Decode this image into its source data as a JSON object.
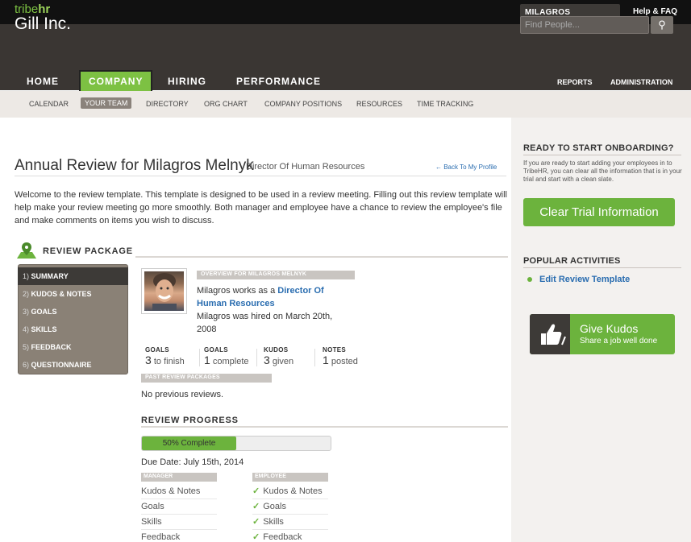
{
  "topbar": {
    "logo_tribe": "tribe",
    "logo_hr": "hr",
    "user_name": "MILAGROS MELNYK",
    "help": "Help & FAQ"
  },
  "header": {
    "company": "Gill Inc.",
    "search_placeholder": "Find People...",
    "nav": [
      "HOME",
      "COMPANY",
      "HIRING",
      "PERFORMANCE"
    ],
    "nav_active": "COMPANY",
    "nav_right": [
      "REPORTS",
      "ADMINISTRATION"
    ]
  },
  "subnav": [
    "CALENDAR",
    "YOUR TEAM",
    "DIRECTORY",
    "ORG CHART",
    "COMPANY POSITIONS",
    "RESOURCES",
    "TIME TRACKING"
  ],
  "subnav_active": "YOUR TEAM",
  "page": {
    "title": "Annual Review for Milagros Melnyk",
    "subtitle": "Director Of Human Resources",
    "back_link": "← Back To My Profile",
    "intro": "Welcome to the review template. This template is designed to be used in a review meeting. Filling out this review template will help make your review meeting go more smoothly. Both manager and employee have a chance to review the employee's file and make comments on items you wish to discuss."
  },
  "review_package": {
    "heading": "REVIEW PACKAGE",
    "menu": [
      {
        "num": "1)",
        "label": "SUMMARY"
      },
      {
        "num": "2)",
        "label": "KUDOS & NOTES"
      },
      {
        "num": "3)",
        "label": "GOALS"
      },
      {
        "num": "4)",
        "label": "SKILLS"
      },
      {
        "num": "5)",
        "label": "FEEDBACK"
      },
      {
        "num": "6)",
        "label": "QUESTIONNAIRE"
      }
    ],
    "overview_label": "OVERVIEW FOR MILAGROS MELNYK",
    "overview_line1": "Milagros works as a ",
    "overview_link": "Director Of Human Resources",
    "overview_line2": "Milagros was hired on March 20th, 2008",
    "stats": [
      {
        "label": "GOALS",
        "value": "3",
        "suffix": "to finish"
      },
      {
        "label": "GOALS",
        "value": "1",
        "suffix": "complete"
      },
      {
        "label": "KUDOS",
        "value": "3",
        "suffix": "given"
      },
      {
        "label": "NOTES",
        "value": "1",
        "suffix": "posted"
      }
    ],
    "past_label": "PAST REVIEW PACKAGES",
    "past_text": "No previous reviews."
  },
  "progress": {
    "heading": "REVIEW PROGRESS",
    "label": "50% Complete",
    "percent": 50,
    "due_date": "Due Date: July 15th, 2014",
    "manager_label": "MANAGER",
    "employee_label": "EMPLOYEE",
    "manager_items": [
      "Kudos & Notes",
      "Goals",
      "Skills",
      "Feedback"
    ],
    "employee_items": [
      "Kudos & Notes",
      "Goals",
      "Skills",
      "Feedback"
    ]
  },
  "sidebar": {
    "onboard_heading": "READY TO START ONBOARDING?",
    "onboard_text": "If you are ready to start adding your employees in to TribeHR, you can clear all the information that is in your trial and start with a clean slate.",
    "clear_button": "Clear Trial Information",
    "popular_heading": "POPULAR ACTIVITIES",
    "popular_item": "Edit Review Template",
    "kudos_title": "Give Kudos",
    "kudos_sub": "Share a job well done"
  },
  "colors": {
    "accent_green": "#6cb33d",
    "dark": "#3a3633",
    "link_blue": "#2a6db0"
  }
}
